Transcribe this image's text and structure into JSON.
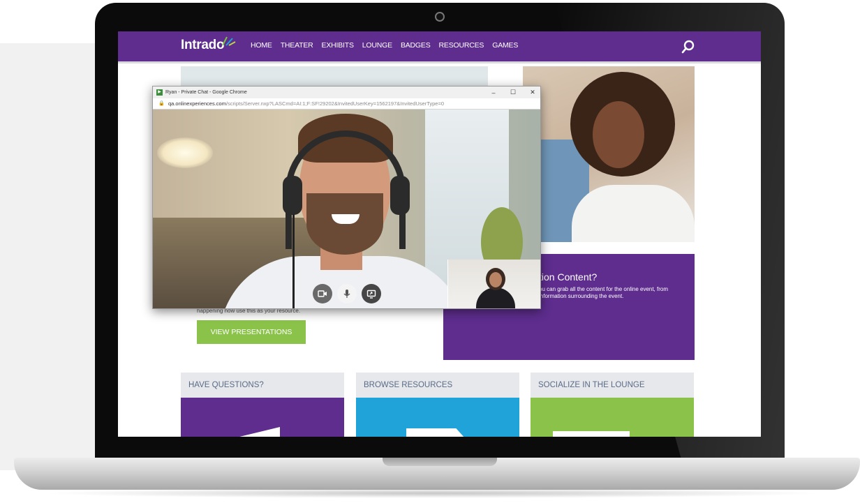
{
  "site": {
    "logo": "Intrado",
    "brand_color": "#5e2d8e",
    "accent_green": "#8bc34a",
    "accent_blue": "#1fa3d9",
    "nav": [
      "HOME",
      "THEATER",
      "EXHIBITS",
      "LOUNGE",
      "BADGES",
      "RESOURCES",
      "GAMES"
    ],
    "search_icon": "search-icon"
  },
  "page": {
    "promo_title": "tion Content?",
    "promo_text": "ou can grab all the content for the online event, from information surrounding the event.",
    "left_text": "happening now use this as your resource.",
    "view_button": "VIEW PRESENTATIONS",
    "cards": [
      {
        "title": "HAVE QUESTIONS?"
      },
      {
        "title": "BROWSE RESOURCES"
      },
      {
        "title": "SOCIALIZE IN THE LOUNGE"
      }
    ]
  },
  "chat_window": {
    "title": "Ryan - Private Chat - Google Chrome",
    "url_host": "qa.onlinexperiences.com",
    "url_path": "/scripts/Server.nxp?LASCmd=AI:1;F:SF!29202&InvitedUserKey=1562197&InvitedUserType=0",
    "controls": {
      "minimize": "–",
      "maximize": "☐",
      "close": "✕"
    },
    "call_controls": [
      "video-camera-icon",
      "microphone-icon",
      "screen-share-icon"
    ]
  }
}
